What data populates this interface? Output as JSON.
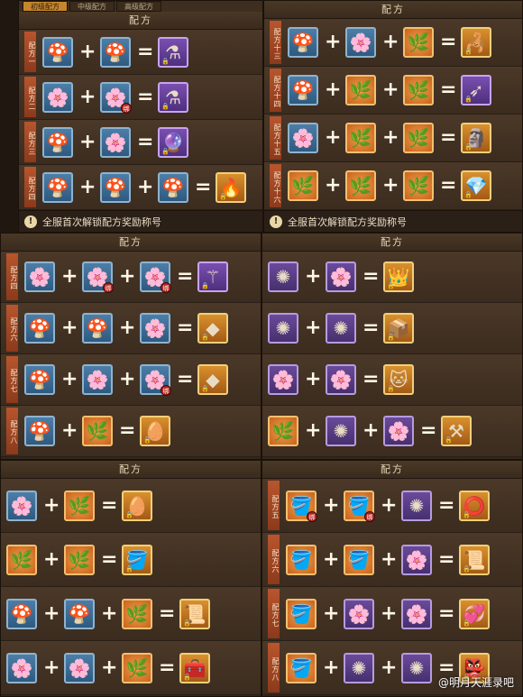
{
  "panel_title": "配方",
  "notice": "全服首次解锁配方奖励称号",
  "tabs": [
    "初级配方",
    "中级配方",
    "高级配方"
  ],
  "watermark": "@明月天涯录吧",
  "ops": {
    "plus": "+",
    "equals": "="
  },
  "bound_badge": "绑",
  "icon_glyphs": {
    "mushroom": "🍄",
    "blue-flower": "🌸",
    "green-herb": "🌿",
    "red-spider-flower": "✺",
    "pink-flower": "🌸",
    "purple-bottle": "⚗",
    "purple-orb": "🔮",
    "blue-flame": "🔥",
    "golden-scorpion": "🦂",
    "arrow-item": "➶",
    "stone-mask": "🗿",
    "crystal": "💎",
    "scepter": "⚚",
    "golden-gem": "◆",
    "golden-egg": "🥚",
    "pink-bucket": "🪣",
    "feather-scroll": "📜",
    "chest": "🧰",
    "golden-warrior": "👑",
    "wooden-box": "📦",
    "white-cat": "🐱",
    "spiked-mace": "⚒",
    "red-ring": "⭕",
    "parchment": "📜",
    "heart-gems": "💞",
    "green-mask": "👺"
  },
  "panels": [
    {
      "id": "top-left",
      "show_title": true,
      "show_tabs": true,
      "show_notice": true,
      "recipes": [
        {
          "label": "配方一",
          "inputs": [
            {
              "icon": "mushroom",
              "color": "blue"
            },
            {
              "icon": "mushroom",
              "color": "blue"
            }
          ],
          "result": {
            "icon": "purple-bottle",
            "color": "result"
          }
        },
        {
          "label": "配方二",
          "inputs": [
            {
              "icon": "blue-flower",
              "color": "blue"
            },
            {
              "icon": "blue-flower",
              "color": "blue",
              "badge": true
            }
          ],
          "result": {
            "icon": "purple-bottle",
            "color": "result"
          }
        },
        {
          "label": "配方三",
          "inputs": [
            {
              "icon": "mushroom",
              "color": "blue"
            },
            {
              "icon": "blue-flower",
              "color": "blue"
            }
          ],
          "result": {
            "icon": "purple-orb",
            "color": "result"
          }
        },
        {
          "label": "配方四",
          "inputs": [
            {
              "icon": "mushroom",
              "color": "blue"
            },
            {
              "icon": "mushroom",
              "color": "blue"
            },
            {
              "icon": "mushroom",
              "color": "blue"
            }
          ],
          "result": {
            "icon": "blue-flame",
            "color": "gold"
          }
        }
      ]
    },
    {
      "id": "top-right",
      "show_title": true,
      "show_tabs": false,
      "show_notice": true,
      "recipes": [
        {
          "label": "配方十三",
          "inputs": [
            {
              "icon": "mushroom",
              "color": "blue"
            },
            {
              "icon": "blue-flower",
              "color": "blue"
            },
            {
              "icon": "green-herb",
              "color": "orange"
            }
          ],
          "result": {
            "icon": "golden-scorpion",
            "color": "gold"
          }
        },
        {
          "label": "配方十四",
          "inputs": [
            {
              "icon": "mushroom",
              "color": "blue"
            },
            {
              "icon": "green-herb",
              "color": "orange"
            },
            {
              "icon": "green-herb",
              "color": "orange"
            }
          ],
          "result": {
            "icon": "arrow-item",
            "color": "result"
          }
        },
        {
          "label": "配方十五",
          "inputs": [
            {
              "icon": "blue-flower",
              "color": "blue"
            },
            {
              "icon": "green-herb",
              "color": "orange"
            },
            {
              "icon": "green-herb",
              "color": "orange"
            }
          ],
          "result": {
            "icon": "stone-mask",
            "color": "gold"
          }
        },
        {
          "label": "配方十六",
          "inputs": [
            {
              "icon": "green-herb",
              "color": "orange"
            },
            {
              "icon": "green-herb",
              "color": "orange"
            },
            {
              "icon": "green-herb",
              "color": "orange"
            }
          ],
          "result": {
            "icon": "crystal",
            "color": "gold"
          }
        }
      ]
    },
    {
      "id": "mid-left",
      "show_title": true,
      "show_tabs": false,
      "show_notice": false,
      "recipes": [
        {
          "label": "配方四",
          "inputs": [
            {
              "icon": "blue-flower",
              "color": "blue"
            },
            {
              "icon": "blue-flower",
              "color": "blue",
              "badge": true
            },
            {
              "icon": "blue-flower",
              "color": "blue",
              "badge": true
            }
          ],
          "result": {
            "icon": "scepter",
            "color": "result"
          }
        },
        {
          "label": "配方六",
          "inputs": [
            {
              "icon": "mushroom",
              "color": "blue"
            },
            {
              "icon": "mushroom",
              "color": "blue"
            },
            {
              "icon": "blue-flower",
              "color": "blue"
            }
          ],
          "result": {
            "icon": "golden-gem",
            "color": "gold"
          }
        },
        {
          "label": "配方七",
          "inputs": [
            {
              "icon": "mushroom",
              "color": "blue"
            },
            {
              "icon": "blue-flower",
              "color": "blue"
            },
            {
              "icon": "blue-flower",
              "color": "blue",
              "badge": true
            }
          ],
          "result": {
            "icon": "golden-gem",
            "color": "gold"
          }
        },
        {
          "label": "配方八",
          "inputs": [
            {
              "icon": "mushroom",
              "color": "blue"
            },
            {
              "icon": "green-herb",
              "color": "orange"
            }
          ],
          "result": {
            "icon": "golden-egg",
            "color": "gold"
          }
        }
      ]
    },
    {
      "id": "mid-right",
      "show_title": true,
      "show_tabs": false,
      "show_notice": false,
      "recipes": [
        {
          "label": "",
          "inputs": [
            {
              "icon": "red-spider-flower",
              "color": "purple"
            },
            {
              "icon": "pink-flower",
              "color": "purple"
            }
          ],
          "result": {
            "icon": "golden-warrior",
            "color": "gold"
          }
        },
        {
          "label": "",
          "inputs": [
            {
              "icon": "red-spider-flower",
              "color": "purple"
            },
            {
              "icon": "red-spider-flower",
              "color": "purple"
            }
          ],
          "result": {
            "icon": "wooden-box",
            "color": "gold"
          }
        },
        {
          "label": "",
          "inputs": [
            {
              "icon": "pink-flower",
              "color": "purple"
            },
            {
              "icon": "pink-flower",
              "color": "purple"
            }
          ],
          "result": {
            "icon": "white-cat",
            "color": "gold"
          }
        },
        {
          "label": "",
          "inputs": [
            {
              "icon": "green-herb",
              "color": "orange"
            },
            {
              "icon": "red-spider-flower",
              "color": "purple"
            },
            {
              "icon": "pink-flower",
              "color": "purple"
            }
          ],
          "result": {
            "icon": "spiked-mace",
            "color": "gold"
          }
        }
      ]
    },
    {
      "id": "bottom-left",
      "show_title": true,
      "show_tabs": false,
      "show_notice": false,
      "recipes": [
        {
          "label": "",
          "inputs": [
            {
              "icon": "blue-flower",
              "color": "blue"
            },
            {
              "icon": "green-herb",
              "color": "orange"
            }
          ],
          "result": {
            "icon": "golden-egg",
            "color": "gold"
          }
        },
        {
          "label": "",
          "inputs": [
            {
              "icon": "green-herb",
              "color": "orange"
            },
            {
              "icon": "green-herb",
              "color": "orange"
            }
          ],
          "result": {
            "icon": "pink-bucket",
            "color": "gold"
          }
        },
        {
          "label": "",
          "inputs": [
            {
              "icon": "mushroom",
              "color": "blue"
            },
            {
              "icon": "mushroom",
              "color": "blue"
            },
            {
              "icon": "green-herb",
              "color": "orange"
            }
          ],
          "result": {
            "icon": "feather-scroll",
            "color": "gold"
          }
        },
        {
          "label": "",
          "inputs": [
            {
              "icon": "blue-flower",
              "color": "blue"
            },
            {
              "icon": "blue-flower",
              "color": "blue"
            },
            {
              "icon": "green-herb",
              "color": "orange"
            }
          ],
          "result": {
            "icon": "chest",
            "color": "gold"
          }
        }
      ]
    },
    {
      "id": "bottom-right",
      "show_title": true,
      "show_tabs": false,
      "show_notice": false,
      "recipes": [
        {
          "label": "配方五",
          "inputs": [
            {
              "icon": "pink-bucket",
              "color": "orange",
              "badge": true
            },
            {
              "icon": "pink-bucket",
              "color": "orange",
              "badge": true
            },
            {
              "icon": "red-spider-flower",
              "color": "purple"
            }
          ],
          "result": {
            "icon": "red-ring",
            "color": "gold"
          }
        },
        {
          "label": "配方六",
          "inputs": [
            {
              "icon": "pink-bucket",
              "color": "orange"
            },
            {
              "icon": "pink-bucket",
              "color": "orange"
            },
            {
              "icon": "pink-flower",
              "color": "purple"
            }
          ],
          "result": {
            "icon": "parchment",
            "color": "gold"
          }
        },
        {
          "label": "配方七",
          "inputs": [
            {
              "icon": "pink-bucket",
              "color": "orange"
            },
            {
              "icon": "pink-flower",
              "color": "purple"
            },
            {
              "icon": "pink-flower",
              "color": "purple"
            }
          ],
          "result": {
            "icon": "heart-gems",
            "color": "gold"
          }
        },
        {
          "label": "配方八",
          "inputs": [
            {
              "icon": "pink-bucket",
              "color": "orange"
            },
            {
              "icon": "red-spider-flower",
              "color": "purple"
            },
            {
              "icon": "red-spider-flower",
              "color": "purple"
            }
          ],
          "result": {
            "icon": "green-mask",
            "color": "gold"
          }
        }
      ]
    }
  ]
}
